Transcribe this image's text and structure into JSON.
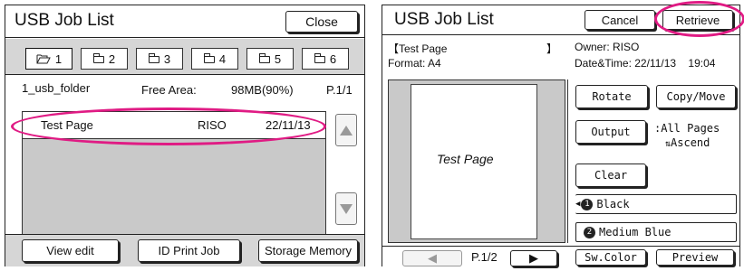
{
  "left": {
    "title": "USB Job List",
    "close_label": "Close",
    "tabs": [
      {
        "label": "1",
        "icon": "open-folder-icon",
        "active": true
      },
      {
        "label": "2",
        "icon": "folder-icon",
        "active": false
      },
      {
        "label": "3",
        "icon": "folder-icon",
        "active": false
      },
      {
        "label": "4",
        "icon": "folder-icon",
        "active": false
      },
      {
        "label": "5",
        "icon": "folder-icon",
        "active": false
      },
      {
        "label": "6",
        "icon": "folder-icon",
        "active": false
      }
    ],
    "folder_name": "1_usb_folder",
    "free_area_label": "Free Area:",
    "free_area_value": "98MB(90%)",
    "page": "P.1/1",
    "jobs": [
      {
        "name": "Test Page",
        "owner": "RISO",
        "date": "22/11/13"
      }
    ],
    "buttons": {
      "view_edit": "View edit",
      "id_print_job": "ID Print Job",
      "storage_memory": "Storage Memory"
    }
  },
  "right": {
    "title": "USB Job List",
    "cancel_label": "Cancel",
    "retrieve_label": "Retrieve",
    "doc_title_open": "【Test Page",
    "doc_title_close": "】",
    "format": "Format: A4",
    "owner": "Owner: RISO",
    "datetime": "Date&Time: 22/11/13    19:04",
    "preview_text": "Test Page",
    "buttons": {
      "rotate": "Rotate",
      "copy_move": "Copy/Move",
      "output": "Output",
      "clear": "Clear",
      "sw_color": "Sw.Color",
      "preview": "Preview"
    },
    "output_info_line1": ":All Pages",
    "output_info_line2": "Ascend",
    "colors": [
      {
        "num": "1",
        "name": "Black",
        "selected": true
      },
      {
        "num": "2",
        "name": "Medium Blue",
        "selected": false
      }
    ],
    "page": "P.1/2"
  },
  "accent_color": "#e01b84"
}
